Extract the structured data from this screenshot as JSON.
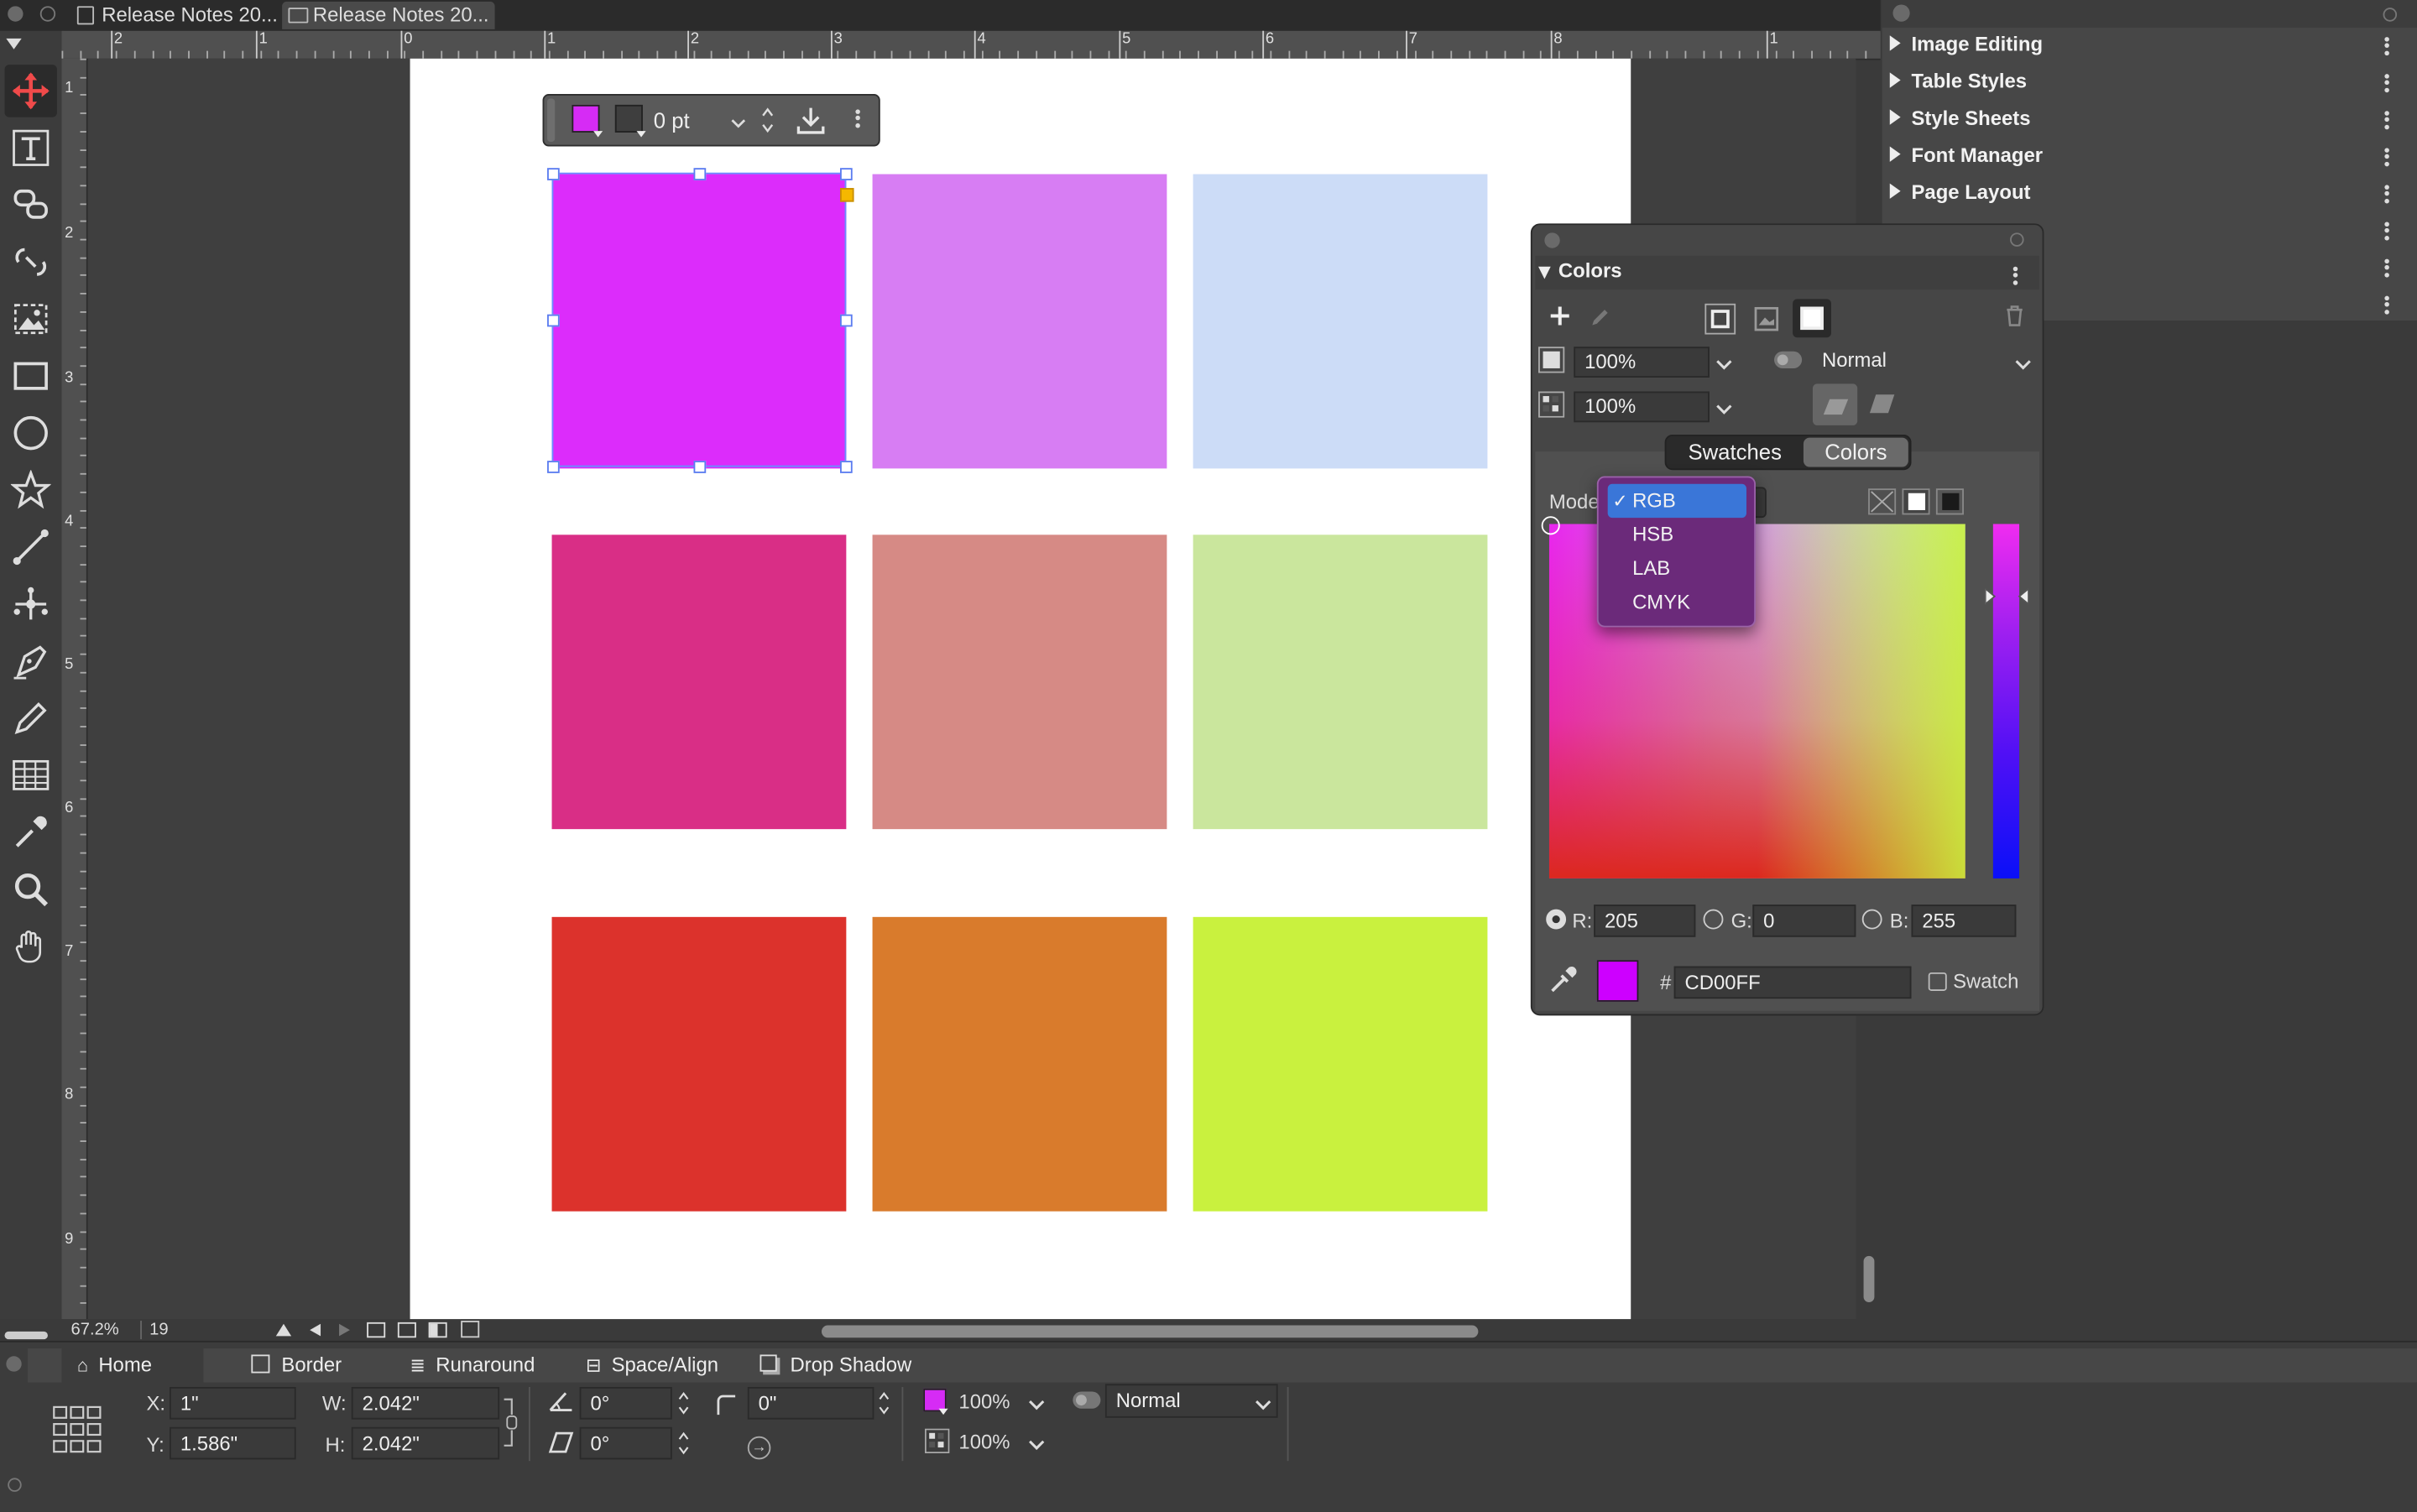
{
  "tabs": [
    {
      "label": "Release Notes 20..."
    },
    {
      "label": "Release Notes 20..."
    }
  ],
  "ruler": {
    "h_ticks": [
      "2",
      "1",
      "0",
      "1",
      "2",
      "3",
      "4",
      "5",
      "6",
      "7",
      "8",
      "1"
    ],
    "v_ticks": [
      "1",
      "2",
      "3",
      "4",
      "5",
      "6",
      "7",
      "8",
      "9"
    ]
  },
  "float_toolbar": {
    "fill_color": "#d62bf5",
    "stroke_width": "0 pt"
  },
  "right_panel": {
    "items": [
      {
        "label": "Image Editing"
      },
      {
        "label": "Table Styles"
      },
      {
        "label": "Style Sheets"
      },
      {
        "label": "Font Manager"
      },
      {
        "label": "Page Layout"
      }
    ]
  },
  "colors_panel": {
    "title": "Colors",
    "opacity_fill": "100%",
    "opacity_shade": "100%",
    "blend_mode": "Normal",
    "tabs": {
      "swatches": "Swatches",
      "colors": "Colors"
    },
    "mode_label": "Mode",
    "mode_options": [
      "RGB",
      "HSB",
      "LAB",
      "CMYK"
    ],
    "mode_selected": "RGB",
    "r_label": "R:",
    "r_value": "205",
    "g_label": "G:",
    "g_value": "0",
    "b_label": "B:",
    "b_value": "255",
    "hex_prefix": "#",
    "hex_value": "CD00FF",
    "swatch_label": "Swatch",
    "current_color": "#cd00ff"
  },
  "swatches": [
    {
      "color": "#dc2cfb"
    },
    {
      "color": "#d77df3"
    },
    {
      "color": "#ccdcf7"
    },
    {
      "color": "#d92e86"
    },
    {
      "color": "#d68a85"
    },
    {
      "color": "#cae69d"
    },
    {
      "color": "#dc322c"
    },
    {
      "color": "#d97b2c"
    },
    {
      "color": "#c9f13e"
    }
  ],
  "status": {
    "zoom": "67.2%",
    "page": "19"
  },
  "bottom": {
    "tabs": [
      "Home",
      "Border",
      "Runaround",
      "Space/Align",
      "Drop Shadow"
    ],
    "x_label": "X:",
    "x_value": "1\"",
    "y_label": "Y:",
    "y_value": "1.586\"",
    "w_label": "W:",
    "w_value": "2.042\"",
    "h_label": "H:",
    "h_value": "2.042\"",
    "angle_value": "0°",
    "skew_value": "0°",
    "corner_value": "0\"",
    "fill_opacity": "100%",
    "shade_opacity": "100%",
    "blend_mode": "Normal"
  }
}
